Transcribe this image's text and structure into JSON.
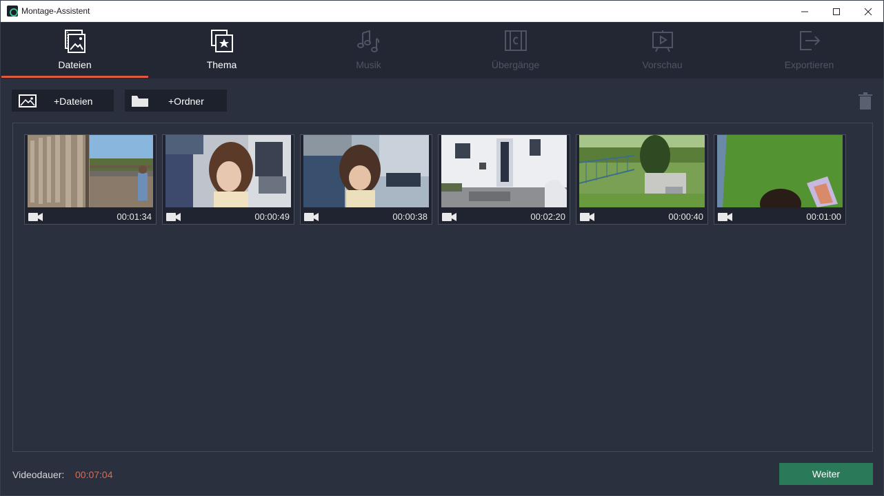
{
  "window": {
    "title": "Montage-Assistent",
    "minimize": "—",
    "maximize": "☐",
    "close": "✕"
  },
  "tabs": [
    {
      "label": "Dateien",
      "icon": "images-icon",
      "state": "active"
    },
    {
      "label": "Thema",
      "icon": "theme-star-icon",
      "state": "enabled"
    },
    {
      "label": "Musik",
      "icon": "music-note-icon",
      "state": "disabled"
    },
    {
      "label": "Übergänge",
      "icon": "transition-icon",
      "state": "disabled"
    },
    {
      "label": "Vorschau",
      "icon": "preview-icon",
      "state": "disabled"
    },
    {
      "label": "Exportieren",
      "icon": "export-icon",
      "state": "disabled"
    }
  ],
  "toolbar": {
    "add_files_label": "+Dateien",
    "add_folder_label": "+Ordner",
    "trash_icon": "trash-icon"
  },
  "media": [
    {
      "duration": "00:01:34",
      "type_icon": "video-camera-icon"
    },
    {
      "duration": "00:00:49",
      "type_icon": "video-camera-icon"
    },
    {
      "duration": "00:00:38",
      "type_icon": "video-camera-icon"
    },
    {
      "duration": "00:02:20",
      "type_icon": "video-camera-icon"
    },
    {
      "duration": "00:00:40",
      "type_icon": "video-camera-icon"
    },
    {
      "duration": "00:01:00",
      "type_icon": "video-camera-icon"
    }
  ],
  "footer": {
    "duration_label": "Videodauer:",
    "duration_value": "00:07:04",
    "next_label": "Weiter"
  },
  "colors": {
    "accent": "#e05a3f",
    "primary_button": "#2a7a5a",
    "background": "#2b303e",
    "toolbar": "#222733"
  }
}
